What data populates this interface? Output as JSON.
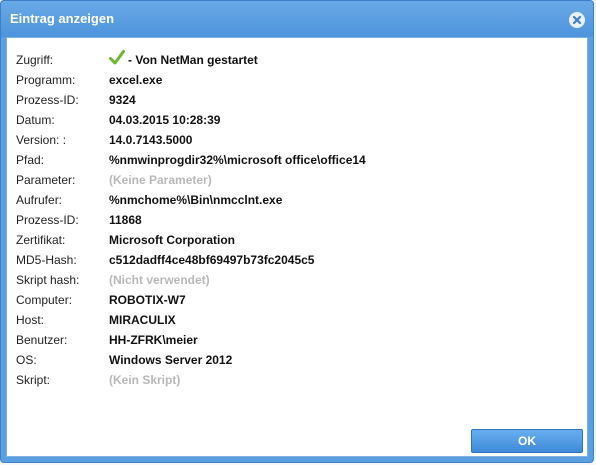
{
  "dialog": {
    "title": "Eintrag anzeigen",
    "close_icon": "close-circle-icon",
    "accent_color": "#5a9fe0"
  },
  "details": {
    "zugriff": {
      "label": "Zugriff:",
      "value": "- Von NetMan gestartet",
      "icon": "check-icon",
      "icon_color": "#6ab82e"
    },
    "programm": {
      "label": "Programm:",
      "value": "excel.exe"
    },
    "prozess_id_1": {
      "label": "Prozess-ID:",
      "value": "9324"
    },
    "datum": {
      "label": "Datum:",
      "value": "04.03.2015 10:28:39"
    },
    "version": {
      "label": "Version: :",
      "value": "14.0.7143.5000"
    },
    "pfad": {
      "label": "Pfad:",
      "value": "%nmwinprogdir32%\\microsoft office\\office14"
    },
    "parameter": {
      "label": "Parameter:",
      "value": "(Keine Parameter)"
    },
    "aufrufer": {
      "label": "Aufrufer:",
      "value": "%nmchome%\\Bin\\nmcclnt.exe"
    },
    "prozess_id_2": {
      "label": "Prozess-ID:",
      "value": "11868"
    },
    "zertifikat": {
      "label": "Zertifikat:",
      "value": "Microsoft Corporation"
    },
    "md5": {
      "label": "MD5-Hash:",
      "value": "c512dadff4ce48bf69497b73fc2045c5"
    },
    "skript_hash": {
      "label": "Skript hash:",
      "value": "(Nicht verwendet)"
    },
    "computer": {
      "label": "Computer:",
      "value": "ROBOTIX-W7"
    },
    "host": {
      "label": "Host:",
      "value": "MIRACULIX"
    },
    "benutzer": {
      "label": "Benutzer:",
      "value": "HH-ZFRK\\meier"
    },
    "os": {
      "label": "OS:",
      "value": "Windows Server 2012"
    },
    "skript": {
      "label": "Skript:",
      "value": "(Kein Skript)"
    }
  },
  "buttons": {
    "ok_label": "OK"
  }
}
